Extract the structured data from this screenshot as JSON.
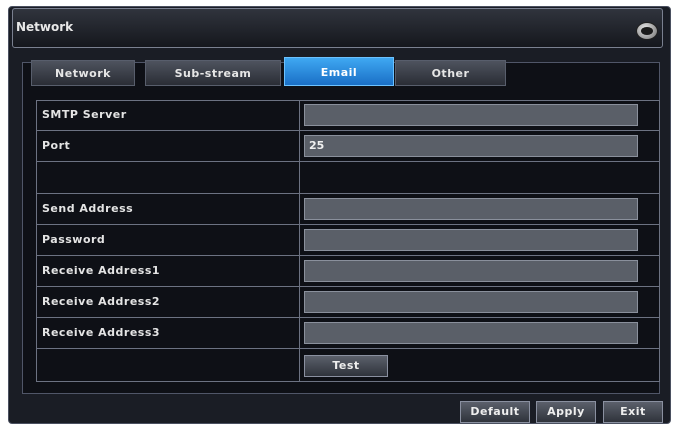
{
  "window": {
    "title": "Network"
  },
  "tabs": [
    {
      "label": "Network",
      "active": false
    },
    {
      "label": "Sub-stream",
      "active": false
    },
    {
      "label": "Email",
      "active": true
    },
    {
      "label": "Other",
      "active": false
    }
  ],
  "form": {
    "smtp_server": {
      "label": "SMTP Server",
      "value": ""
    },
    "port": {
      "label": "Port",
      "value": "25"
    },
    "send_address": {
      "label": "Send Address",
      "value": ""
    },
    "password": {
      "label": "Password",
      "value": ""
    },
    "receive_address1": {
      "label": "Receive Address1",
      "value": ""
    },
    "receive_address2": {
      "label": "Receive Address2",
      "value": ""
    },
    "receive_address3": {
      "label": "Receive Address3",
      "value": ""
    },
    "test_label": "Test"
  },
  "footer": {
    "default_label": "Default",
    "apply_label": "Apply",
    "exit_label": "Exit"
  },
  "icons": {
    "close": "close-icon"
  },
  "colors": {
    "active_tab": "#2a8ee0"
  }
}
